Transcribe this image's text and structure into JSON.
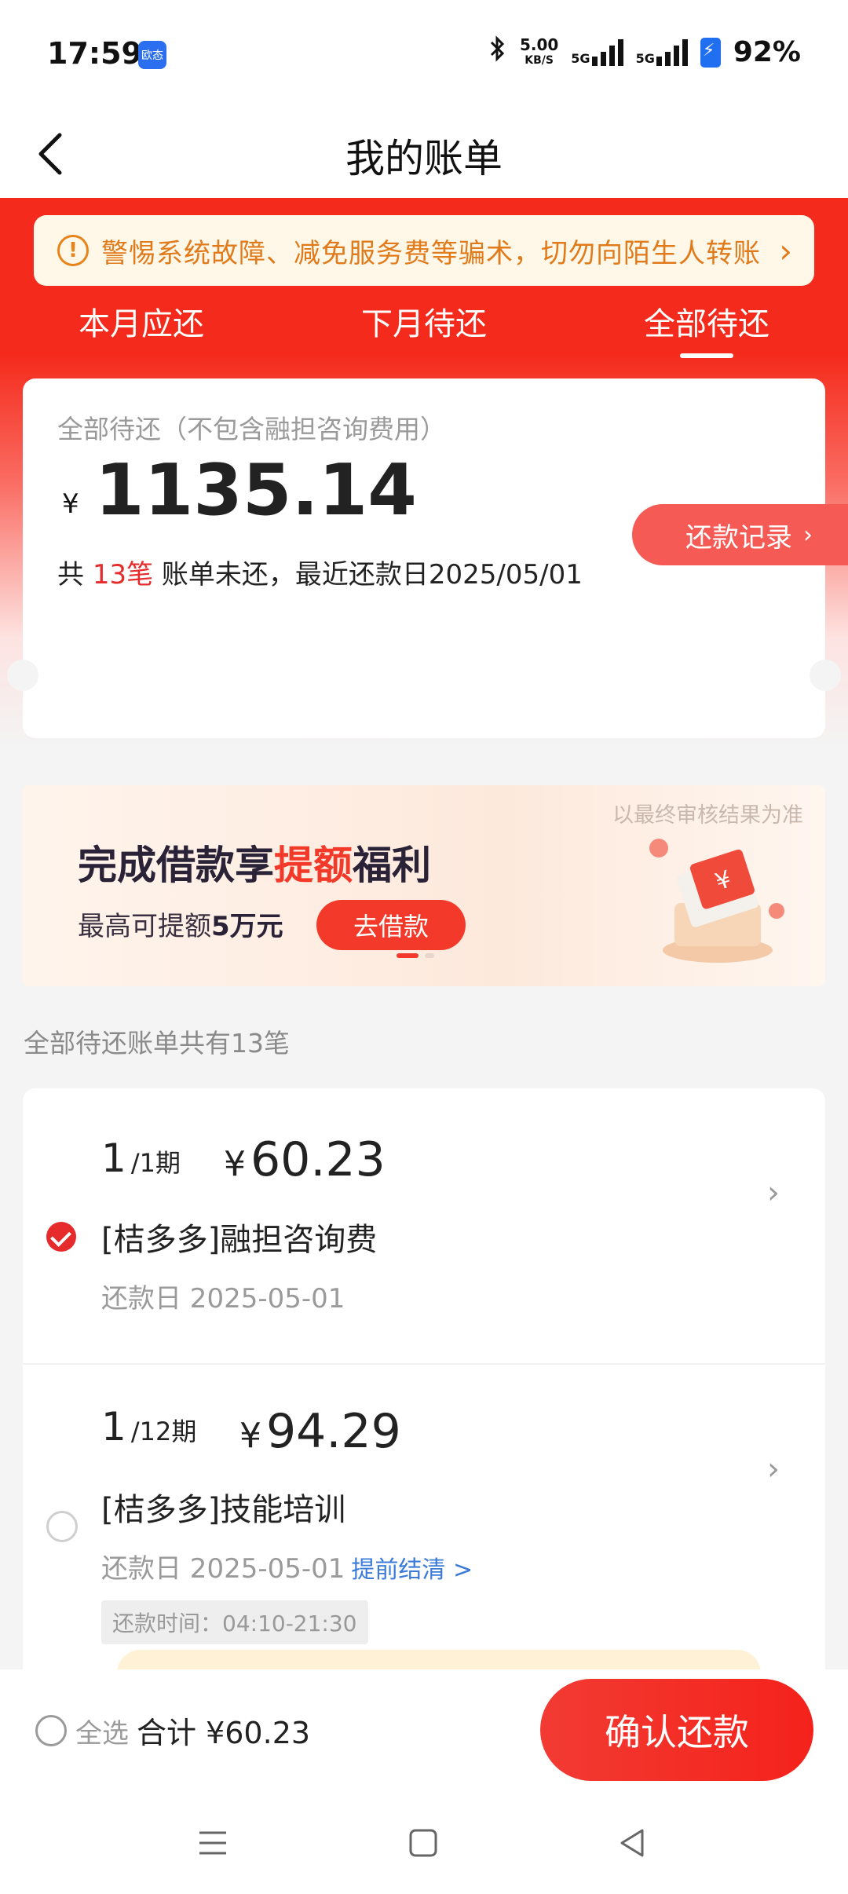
{
  "status_bar": {
    "time": "17:59",
    "app_badge": "欧态",
    "net_speed_value": "5.00",
    "net_speed_unit": "KB/S",
    "signal1": "5G",
    "signal2": "5G",
    "battery": "92%"
  },
  "nav": {
    "title": "我的账单"
  },
  "notice": {
    "text": "警惕系统故障、减免服务费等骗术，切勿向陌生人转账"
  },
  "tabs": [
    {
      "label": "本月应还",
      "active": false
    },
    {
      "label": "下月待还",
      "active": false
    },
    {
      "label": "全部待还",
      "active": true
    }
  ],
  "summary": {
    "label": "全部待还（不包含融担咨询费用）",
    "currency": "¥",
    "amount": "1135.14",
    "note_prefix": "共 ",
    "note_count": "13笔",
    "note_suffix": " 账单未还，最近还款日2025/05/01",
    "records_button": "还款记录"
  },
  "banner": {
    "note": "以最终审核结果为准",
    "title_a": "完成借款享",
    "title_hot": "提额",
    "title_b": "福利",
    "sub_a": "最高可提额",
    "sub_b": "5万元",
    "button": "去借款"
  },
  "list_caption": "全部待还账单共有13笔",
  "bills": [
    {
      "period_num": "1",
      "period_total": "/1期",
      "currency": "¥",
      "amount": "60.23",
      "name": "[桔多多]融担咨询费",
      "due_date": "还款日 2025-05-01",
      "checked": true
    },
    {
      "period_num": "1",
      "period_total": "/12期",
      "currency": "¥",
      "amount": "94.29",
      "name": "[桔多多]技能培训",
      "due_date": "还款日 2025-05-01",
      "early_settle": "提前结清 >",
      "repay_time": "还款时间：04:10-21:30",
      "checked": false
    }
  ],
  "bottom": {
    "select_all": "全选",
    "total": "合计 ¥60.23",
    "confirm": "确认还款"
  },
  "colors": {
    "brand_red": "#f42b1c",
    "accent_red": "#e52b2b",
    "notice_orange": "#e07a1a",
    "link_blue": "#3b7bd8"
  }
}
